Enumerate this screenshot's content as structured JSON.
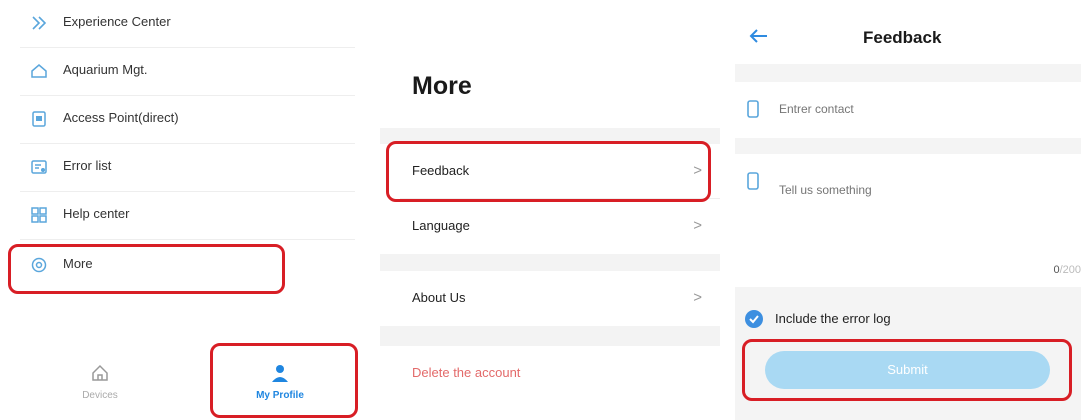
{
  "profile_screen": {
    "menu_items": [
      {
        "label": "Experience Center",
        "icon": "experience-center-icon"
      },
      {
        "label": "Aquarium Mgt.",
        "icon": "aquarium-icon"
      },
      {
        "label": "Access Point(direct)",
        "icon": "access-point-icon"
      },
      {
        "label": "Error list",
        "icon": "error-list-icon"
      },
      {
        "label": "Help center",
        "icon": "help-center-icon"
      },
      {
        "label": "More",
        "icon": "more-icon"
      }
    ],
    "tabs": [
      {
        "label": "Devices",
        "icon": "home-icon",
        "active": false
      },
      {
        "label": "My Profile",
        "icon": "person-icon",
        "active": true
      }
    ]
  },
  "more_screen": {
    "title": "More",
    "items": [
      {
        "label": "Feedback",
        "chevron": ">"
      },
      {
        "label": "Language",
        "chevron": ">"
      },
      {
        "label": "About Us",
        "chevron": ">"
      }
    ],
    "delete_label": "Delete the account"
  },
  "feedback_screen": {
    "title": "Feedback",
    "contact_placeholder": "Entrer contact",
    "message_placeholder": "Tell us something",
    "counter_current": "0",
    "counter_max": "/200",
    "include_log_label": "Include the error log",
    "include_log_checked": true,
    "submit_label": "Submit"
  },
  "colors": {
    "highlight": "#d81e25",
    "accent": "#1f86e0",
    "submit_bg": "#a9d9f3",
    "danger_text": "#e36a6a"
  }
}
